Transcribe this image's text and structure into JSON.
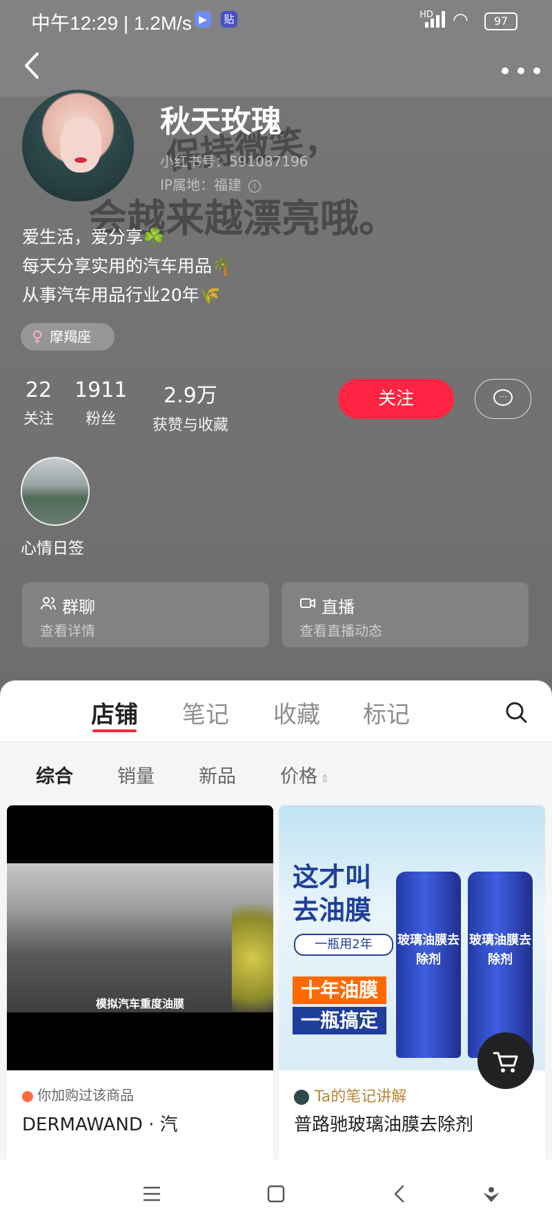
{
  "status_bar": {
    "time": "中午12:29 | 1.2M/s",
    "network": "HD",
    "battery": "97"
  },
  "background_text": {
    "line1": "保持微笑，",
    "line2": "会越来越漂亮哦。"
  },
  "profile": {
    "nickname": "秋天玫瑰",
    "red_id": "小红书号：591087196",
    "ip_location": "IP属地：福建",
    "bio": [
      "爱生活，爱分享☘️",
      "每天分享实用的汽车用品🌴",
      "从事汽车用品行业20年🌾"
    ],
    "tag": "摩羯座",
    "tag_symbol": "♀"
  },
  "stats": [
    {
      "value": "22",
      "label": "关注"
    },
    {
      "value": "1911",
      "label": "粉丝"
    },
    {
      "value": "2.9万",
      "label": "获赞与收藏"
    }
  ],
  "actions": {
    "follow": "关注"
  },
  "highlight": {
    "label": "心情日签"
  },
  "cards": [
    {
      "title": "群聊",
      "subtitle": "查看详情",
      "icon": "group-icon"
    },
    {
      "title": "直播",
      "subtitle": "查看直播动态",
      "icon": "live-icon"
    }
  ],
  "tabs": [
    {
      "label": "店铺",
      "active": true
    },
    {
      "label": "笔记",
      "active": false
    },
    {
      "label": "收藏",
      "active": false
    },
    {
      "label": "标记",
      "active": false
    }
  ],
  "filters": [
    {
      "label": "综合",
      "active": true
    },
    {
      "label": "销量",
      "active": false
    },
    {
      "label": "新品",
      "active": false
    },
    {
      "label": "价格",
      "active": false
    }
  ],
  "products": [
    {
      "image_caption": "模拟汽车重度油膜",
      "badge": "你加购过该商品",
      "title": "DERMAWAND · 汽"
    },
    {
      "image_headline": "这才叫去油膜",
      "image_pill": "一瓶用2年",
      "image_banner1": "十年油膜",
      "image_banner2": "一瓶搞定",
      "can_text": "玻璃油膜去除剂",
      "badge": "Ta的笔记讲解",
      "title": "普路驰玻璃油膜去除剂"
    }
  ],
  "colors": {
    "accent": "#ff2442",
    "header_bg": "#767676"
  }
}
